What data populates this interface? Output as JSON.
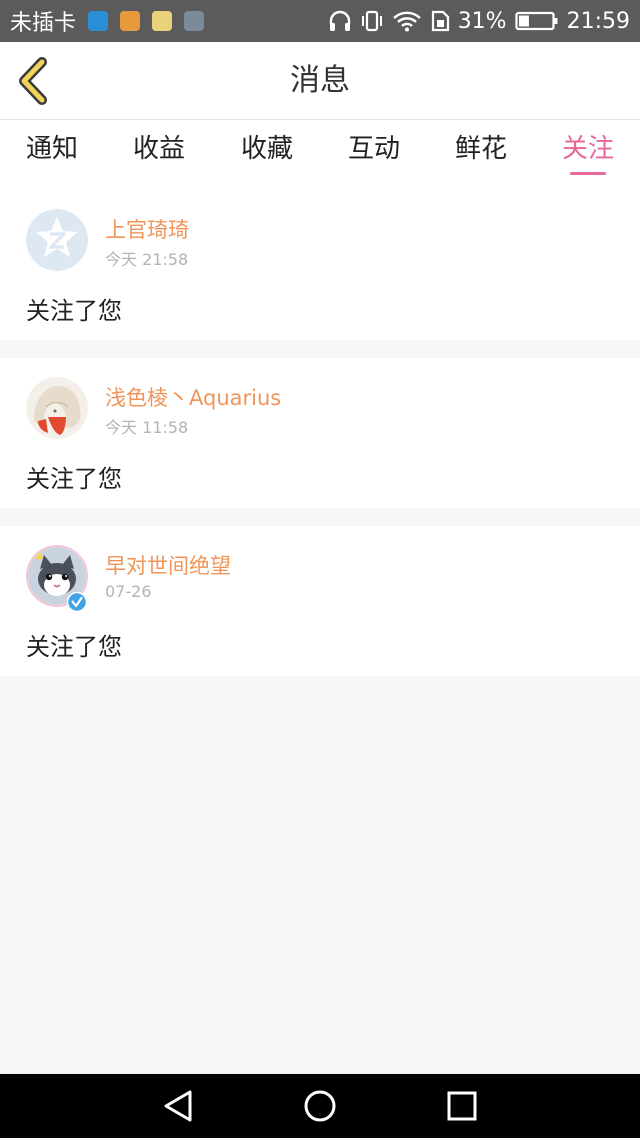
{
  "status_bar": {
    "carrier": "未插卡",
    "app_icon_colors": [
      "#2b8fd8",
      "#e69a3b",
      "#e9d27a",
      "#7a8a99"
    ],
    "battery_percent": "31%",
    "battery_level": 0.31,
    "time": "21:59"
  },
  "header": {
    "back_icon": "chevron-left-icon",
    "title": "消息"
  },
  "tabs": [
    {
      "label": "通知",
      "active": false
    },
    {
      "label": "收益",
      "active": false
    },
    {
      "label": "收藏",
      "active": false
    },
    {
      "label": "互动",
      "active": false
    },
    {
      "label": "鲜花",
      "active": false
    },
    {
      "label": "关注",
      "active": true
    }
  ],
  "messages": [
    {
      "username": "上官琦琦",
      "time": "今天 21:58",
      "text": "关注了您",
      "avatar": "default-avatar-icon",
      "verified": false
    },
    {
      "username": "浅色棱丶Aquarius",
      "time": "今天 11:58",
      "text": "关注了您",
      "avatar": "anime-girl-avatar",
      "verified": false
    },
    {
      "username": "早对世间绝望",
      "time": "07-26",
      "text": "关注了您",
      "avatar": "cat-avatar",
      "verified": true
    }
  ],
  "colors": {
    "accent_pink": "#e8679a",
    "username_orange": "#f0955a",
    "back_icon_yellow": "#f2d35a",
    "verified_blue": "#3fa3e6"
  },
  "nav_bar": {
    "back_icon": "triangle-back-icon",
    "home_icon": "circle-home-icon",
    "recents_icon": "square-recents-icon"
  }
}
